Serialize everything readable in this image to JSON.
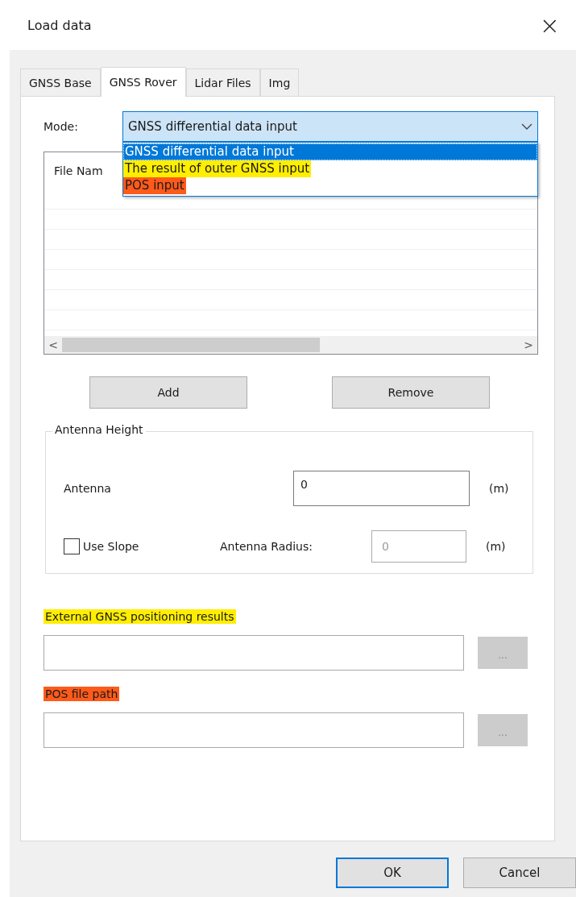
{
  "window": {
    "title": "Load data",
    "close": "×"
  },
  "tabs": [
    {
      "label": "GNSS Base",
      "selected": false
    },
    {
      "label": "GNSS Rover",
      "selected": true
    },
    {
      "label": "Lidar Files",
      "selected": false
    },
    {
      "label": "Img",
      "selected": false
    }
  ],
  "mode": {
    "label": "Mode:",
    "value": "GNSS differential data input",
    "options": [
      {
        "label": "GNSS differential data input",
        "selected": true
      },
      {
        "label": "The result of outer GNSS input",
        "selected": false,
        "color": "#ffee00"
      },
      {
        "label": "POS input",
        "selected": false,
        "color": "#ff5a1a"
      }
    ]
  },
  "file_list": {
    "columns": [
      "File Nam"
    ],
    "scroll_left": "<",
    "scroll_right": ">"
  },
  "buttons": [
    "Add",
    "Remove"
  ],
  "antenna_group": {
    "title": "Antenna Height",
    "antenna_label": "Antenna",
    "antenna_value": "0",
    "antenna_unit": "(m)",
    "use_slope": {
      "label": "Use Slope",
      "checked": false
    },
    "radius_label": "Antenna Radius:",
    "radius_value": "0",
    "radius_unit": "(m)",
    "radius_disabled": true
  },
  "path_fields": [
    {
      "label": "External GNSS positioning results",
      "color": "#ffee00",
      "browse": "..."
    },
    {
      "label": "POS file path",
      "color": "#ff5a1a",
      "browse": "..."
    }
  ],
  "footer": [
    {
      "label": "OK",
      "default": true
    },
    {
      "label": "Cancel",
      "default": false
    }
  ]
}
